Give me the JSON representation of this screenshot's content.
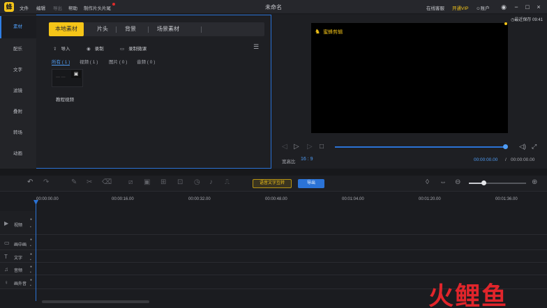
{
  "titlebar": {
    "menu": [
      "文件",
      "编辑",
      "导出",
      "帮助",
      "制作片头片尾"
    ],
    "menu_disabled_index": 2,
    "window_title": "未命名",
    "online_service": "在线客服",
    "vip": "开通VIP",
    "account": "账户",
    "minimize": "−",
    "maximize": "□",
    "close": "×"
  },
  "sidebar": {
    "items": [
      "素材",
      "配乐",
      "文字",
      "滤镜",
      "叠附",
      "转场",
      "动画"
    ],
    "active_index": 0
  },
  "media": {
    "tabs": [
      "本地素材",
      "片头",
      "背景",
      "场景素材"
    ],
    "active_tab": 0,
    "tools": {
      "import": "导入",
      "record": "录制",
      "record_lesson": "录制微课"
    },
    "filters": [
      "所有 ( 1 )",
      "视频 ( 1 )",
      "图片 ( 0 )",
      "音频 ( 0 )"
    ],
    "active_filter": 0,
    "items": [
      {
        "label": "教程视频"
      }
    ]
  },
  "preview": {
    "save_status": "最近保存 09:41",
    "watermark": "蜜蜂剪辑",
    "ratio_label": "宽高比",
    "ratio_value": "16 : 9",
    "time_current": "00:00:00.00",
    "time_sep": "/",
    "time_total": "00:00:00.00",
    "progress": 1.0
  },
  "edit_toolbar": {
    "speech_to_text": "语音文字互转",
    "export": "导出",
    "zoom": 0.27
  },
  "timeline": {
    "ticks": [
      "00:00:00.00",
      "00:00:16.00",
      "00:00:32.00",
      "00:00:48.00",
      "00:01:04.00",
      "00:01:20.00",
      "00:01:36.00"
    ],
    "tracks": [
      "视频",
      "画中画",
      "文字",
      "音频",
      "画外音"
    ]
  },
  "brand": {
    "text_a": "火",
    "text_b": "鲤鱼"
  },
  "colors": {
    "accent_yellow": "#f5c518",
    "accent_blue": "#2b73d6",
    "brand_red": "#e1252b"
  }
}
